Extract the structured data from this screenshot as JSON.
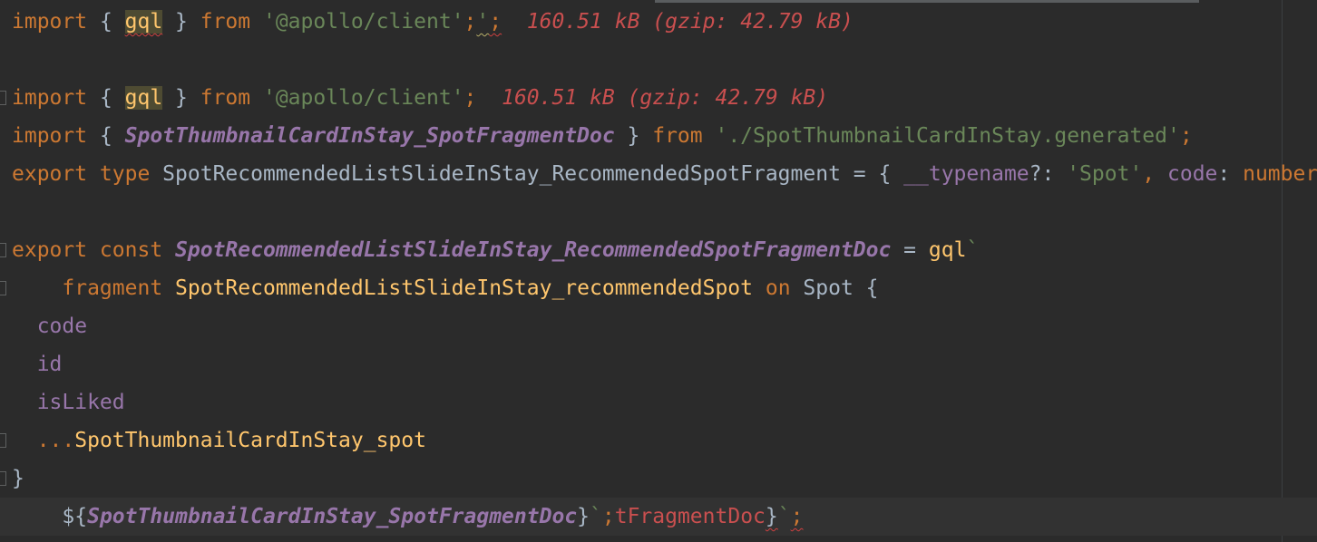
{
  "editor": {
    "current_line": 12,
    "fold_lines": [
      2,
      6,
      7,
      11,
      12
    ],
    "lines": [
      [
        [
          "import",
          "kw"
        ],
        [
          " { ",
          "def"
        ],
        [
          "gql",
          "hl wr"
        ],
        [
          " } ",
          "def"
        ],
        [
          "from",
          "kw"
        ],
        [
          " ",
          "def"
        ],
        [
          "'@apollo/client'",
          "str"
        ],
        [
          ";",
          "kw"
        ],
        [
          "'",
          "str wy"
        ],
        [
          ";",
          "kw wr"
        ],
        [
          "  160.51 kB (gzip: 42.79 kB)",
          "hint"
        ]
      ],
      [],
      [
        [
          "import",
          "kw"
        ],
        [
          " { ",
          "def"
        ],
        [
          "gql",
          "hl"
        ],
        [
          " } ",
          "def"
        ],
        [
          "from",
          "kw"
        ],
        [
          " ",
          "def"
        ],
        [
          "'@apollo/client'",
          "str"
        ],
        [
          ";",
          "kw"
        ],
        [
          "  160.51 kB (gzip: 42.79 kB)",
          "hint"
        ]
      ],
      [
        [
          "import",
          "kw"
        ],
        [
          " { ",
          "def"
        ],
        [
          "SpotThumbnailCardInStay_SpotFragmentDoc",
          "pi"
        ],
        [
          " } ",
          "def"
        ],
        [
          "from",
          "kw"
        ],
        [
          " ",
          "def"
        ],
        [
          "'./SpotThumbnailCardInStay.generated'",
          "str"
        ],
        [
          ";",
          "kw"
        ]
      ],
      [
        [
          "export type",
          "kw"
        ],
        [
          " SpotRecommendedListSlideInStay_RecommendedSpotFragment = { ",
          "def"
        ],
        [
          "__typename",
          "prop"
        ],
        [
          "?: ",
          "def"
        ],
        [
          "'Spot'",
          "str"
        ],
        [
          ",",
          "kw"
        ],
        [
          " ",
          "def"
        ],
        [
          "code",
          "prop"
        ],
        [
          ": ",
          "def"
        ],
        [
          "number",
          "kw"
        ]
      ],
      [],
      [
        [
          "export const",
          "kw"
        ],
        [
          " ",
          "def"
        ],
        [
          "SpotRecommendedListSlideInStay_RecommendedSpotFragmentDoc",
          "pi"
        ],
        [
          " = ",
          "def"
        ],
        [
          "gql",
          "fn"
        ],
        [
          "`",
          "str"
        ]
      ],
      [
        [
          "    fragment",
          "kw"
        ],
        [
          " ",
          "def"
        ],
        [
          "SpotRecommendedListSlideInStay_recommendedSpot",
          "fn"
        ],
        [
          " ",
          "def"
        ],
        [
          "on",
          "kw"
        ],
        [
          " Spot {",
          "def"
        ]
      ],
      [
        [
          "  code",
          "prop"
        ]
      ],
      [
        [
          "  id",
          "prop"
        ]
      ],
      [
        [
          "  isLiked",
          "prop"
        ]
      ],
      [
        [
          "  ...",
          "kw"
        ],
        [
          "SpotThumbnailCardInStay_spot",
          "fn"
        ]
      ],
      [
        [
          "}",
          "def"
        ]
      ],
      [
        [
          "    ${",
          "def"
        ],
        [
          "SpotThumbnailCardInStay_SpotFragmentDoc",
          "pi"
        ],
        [
          "}",
          "def"
        ],
        [
          "`",
          "str"
        ],
        [
          ";",
          "kw"
        ],
        [
          "tFragmentDoc",
          "err"
        ],
        [
          "}",
          "def wr"
        ],
        [
          "`",
          "str"
        ],
        [
          ";",
          "kw wr"
        ]
      ]
    ]
  }
}
